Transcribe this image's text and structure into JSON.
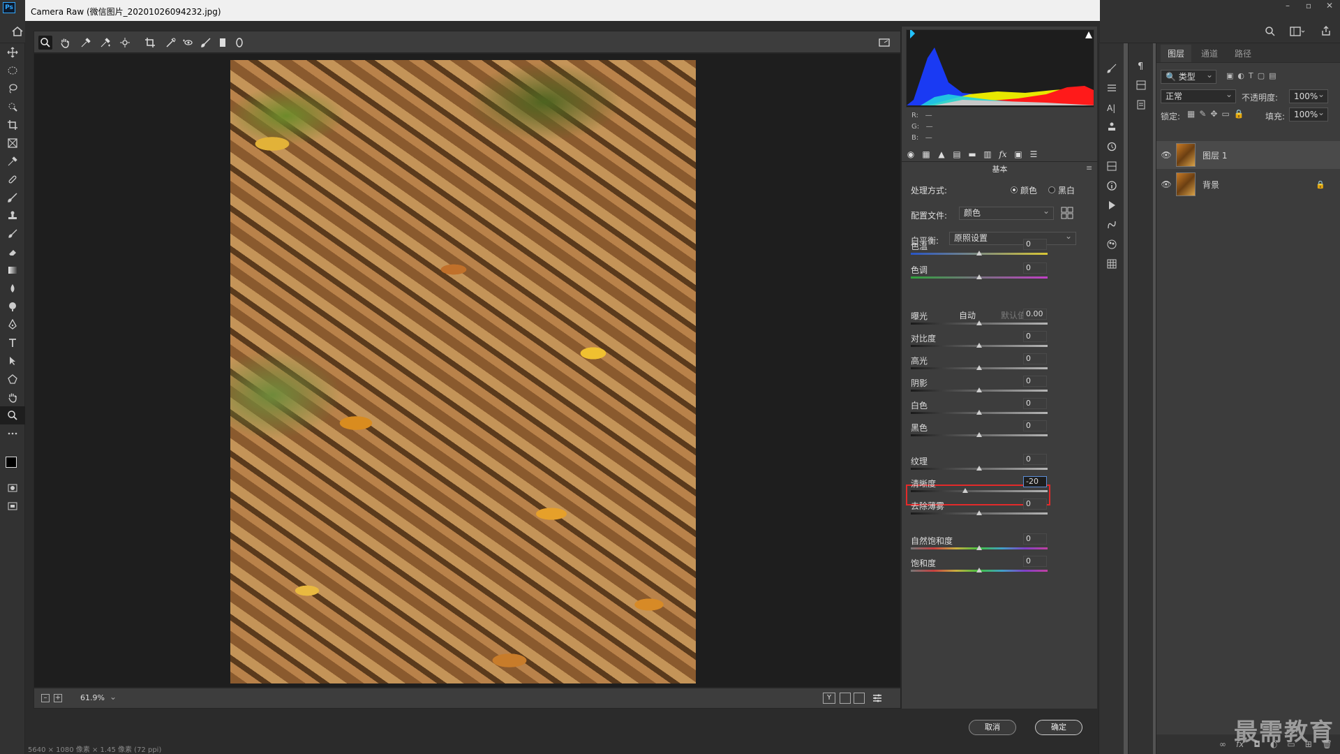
{
  "photoshop": {
    "logo": "Ps",
    "window_controls": [
      "–",
      "▫",
      "✕"
    ],
    "layers_panel": {
      "tabs": [
        "图层",
        "通道",
        "路径"
      ],
      "kind_filter": "类型",
      "blend_mode": "正常",
      "opacity_label": "不透明度:",
      "opacity_value": "100%",
      "lock_label": "锁定:",
      "fill_label": "填充:",
      "fill_value": "100%",
      "layers": [
        {
          "name": "图层 1",
          "visible": true,
          "locked": false,
          "selected": true
        },
        {
          "name": "背景",
          "visible": true,
          "locked": true,
          "selected": false
        }
      ],
      "footer_icons": [
        "link-icon",
        "fx-icon",
        "mask-icon",
        "adjustment-icon",
        "folder-icon",
        "new-layer-icon",
        "trash-icon"
      ]
    },
    "watermark": "最需教育",
    "status_text": "5640 × 1080 像素 × 1.45 像素 (72 ppi)"
  },
  "acr": {
    "title": "Camera Raw (微信图片_20201026094232.jpg)",
    "zoom": "61.9%",
    "rgb": {
      "r_label": "R:",
      "g_label": "G:",
      "b_label": "B:",
      "r": "—",
      "g": "—",
      "b": "—"
    },
    "panel_header": "基本",
    "treatment": {
      "label": "处理方式:",
      "color": "颜色",
      "bw": "黑白",
      "selected": "color"
    },
    "profile": {
      "label": "配置文件:",
      "value": "颜色"
    },
    "white_balance": {
      "label": "白平衡:",
      "value": "原照设置"
    },
    "auto_label": "自动",
    "default_label": "默认值",
    "sliders": [
      {
        "key": "temp",
        "name": "色温",
        "value": "0",
        "position": 0.5
      },
      {
        "key": "tint",
        "name": "色调",
        "value": "0",
        "position": 0.5
      },
      {
        "key": "exposure",
        "name": "曝光",
        "value": "0.00",
        "position": 0.5
      },
      {
        "key": "contrast",
        "name": "对比度",
        "value": "0",
        "position": 0.5
      },
      {
        "key": "highlights",
        "name": "高光",
        "value": "0",
        "position": 0.5
      },
      {
        "key": "shadows",
        "name": "阴影",
        "value": "0",
        "position": 0.5
      },
      {
        "key": "whites",
        "name": "白色",
        "value": "0",
        "position": 0.5
      },
      {
        "key": "blacks",
        "name": "黑色",
        "value": "0",
        "position": 0.5
      },
      {
        "key": "texture",
        "name": "纹理",
        "value": "0",
        "position": 0.5
      },
      {
        "key": "clarity",
        "name": "清晰度",
        "value": "-20",
        "position": 0.4
      },
      {
        "key": "dehaze",
        "name": "去除薄雾",
        "value": "0",
        "position": 0.5
      },
      {
        "key": "vibrance",
        "name": "自然饱和度",
        "value": "0",
        "position": 0.5
      },
      {
        "key": "saturation",
        "name": "饱和度",
        "value": "0",
        "position": 0.5
      }
    ],
    "buttons": {
      "cancel": "取消",
      "ok": "确定"
    }
  },
  "colors": {
    "highlight": "#e32a2a",
    "ps_accent": "#31a8ff"
  }
}
